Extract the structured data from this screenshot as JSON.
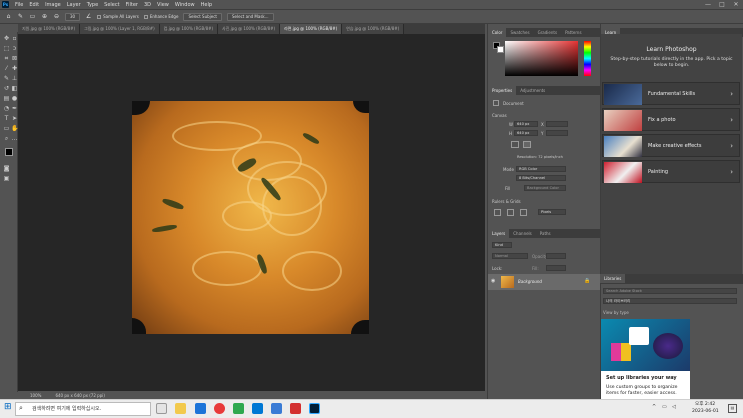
{
  "app": {
    "logo": "Ps"
  },
  "menu": [
    "File",
    "Edit",
    "Image",
    "Layer",
    "Type",
    "Select",
    "Filter",
    "3D",
    "View",
    "Window",
    "Help"
  ],
  "window_controls": {
    "minimize": "—",
    "maximize": "□",
    "close": "✕"
  },
  "options_bar": {
    "size": "30",
    "sample_all_layers": "Sample All Layers",
    "enhance_edge": "Enhance Edge",
    "select_subject": "Select Subject",
    "select_and_mask": "Select and Mask..."
  },
  "doc_tabs": [
    "지원.jpg @ 100% (RGB/8#)",
    "그림.jpg @ 100% (Layer 1, RGB/8#)",
    "컵.jpg @ 100% (RGB/8#)",
    "사진.jpg @ 100% (RGB/8#)",
    "라면.jpg @ 100% (RGB/8#)",
    "연습.jpg @ 100% (RGB/8#)"
  ],
  "status": {
    "zoom": "100%",
    "dimensions": "640 px x 640 px (72 ppi)"
  },
  "color_panel": {
    "tabs": [
      "Color",
      "Swatches",
      "Gradients",
      "Patterns"
    ],
    "accent": "#e53333"
  },
  "properties_panel": {
    "tabs": [
      "Properties",
      "Adjustments"
    ],
    "doc_label": "Document",
    "canvas_title": "Canvas",
    "w_label": "W",
    "w_value": "640 px",
    "h_label": "H",
    "h_value": "640 px",
    "x_label": "X",
    "y_label": "Y",
    "resolution": "Resolution: 72 pixels/inch",
    "mode_label": "Mode",
    "mode_value": "RGB Color",
    "depth_value": "8 Bits/Channel",
    "fill_label": "Fill",
    "fill_value": "Background Color",
    "rulers_title": "Rulers & Grids",
    "units_value": "Pixels"
  },
  "layers_panel": {
    "tabs": [
      "Layers",
      "Channels",
      "Paths"
    ],
    "kind_label": "Kind",
    "blend_mode": "Normal",
    "opacity_label": "Opacity:",
    "lock_label": "Lock:",
    "fill_label": "Fill:",
    "layer_name": "Background"
  },
  "learn_panel": {
    "tab": "Learn",
    "title": "Learn Photoshop",
    "description": "Step-by-step tutorials directly in the app. Pick a topic below to begin.",
    "cards": [
      "Fundamental Skills",
      "Fix a photo",
      "Make creative effects",
      "Painting"
    ]
  },
  "libraries_panel": {
    "tab": "Libraries",
    "search_placeholder": "Search Adobe Stock",
    "library_name": "나의 라이브러리",
    "view_by": "View by type",
    "promo_title": "Set up libraries your way",
    "promo_text": "Use custom groups to organize items for faster, easier access."
  },
  "taskbar": {
    "search_placeholder": "검색하려면 여기에 입력하십시오.",
    "time": "오후 2:42",
    "date": "2023-06-01"
  }
}
